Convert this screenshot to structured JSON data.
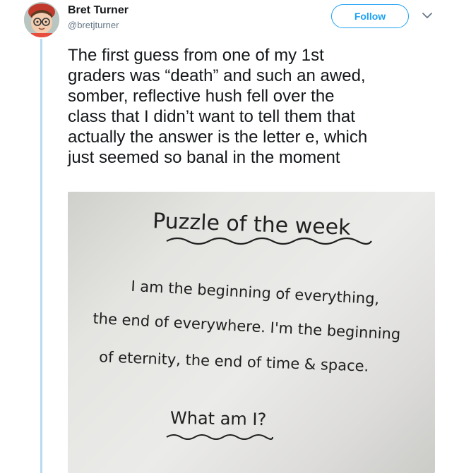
{
  "author": {
    "name": "Bret Turner",
    "handle": "@bretjturner",
    "avatar_icon": "cartoon-child-avatar"
  },
  "follow_label": "Follow",
  "menu_icon": "chevron-down-icon",
  "tweet_lines": [
    "The first guess from one of my 1st",
    "graders was “death” and such an awed,",
    "somber, reflective hush fell over the",
    "class that I didn’t want to tell them that",
    "actually the answer is the letter e, which",
    "just seemed so banal in the moment"
  ],
  "whiteboard": {
    "heading": "Puzzle of the week",
    "riddle_lines": [
      "I am the beginning of everything,",
      "the end of everywhere. I'm the beginning",
      "of eternity, the end of time & space."
    ],
    "question": "What am I?"
  },
  "colors": {
    "accent": "#1da1f2",
    "thread_line": "#b6dbf5",
    "handle_gray": "#657786"
  }
}
